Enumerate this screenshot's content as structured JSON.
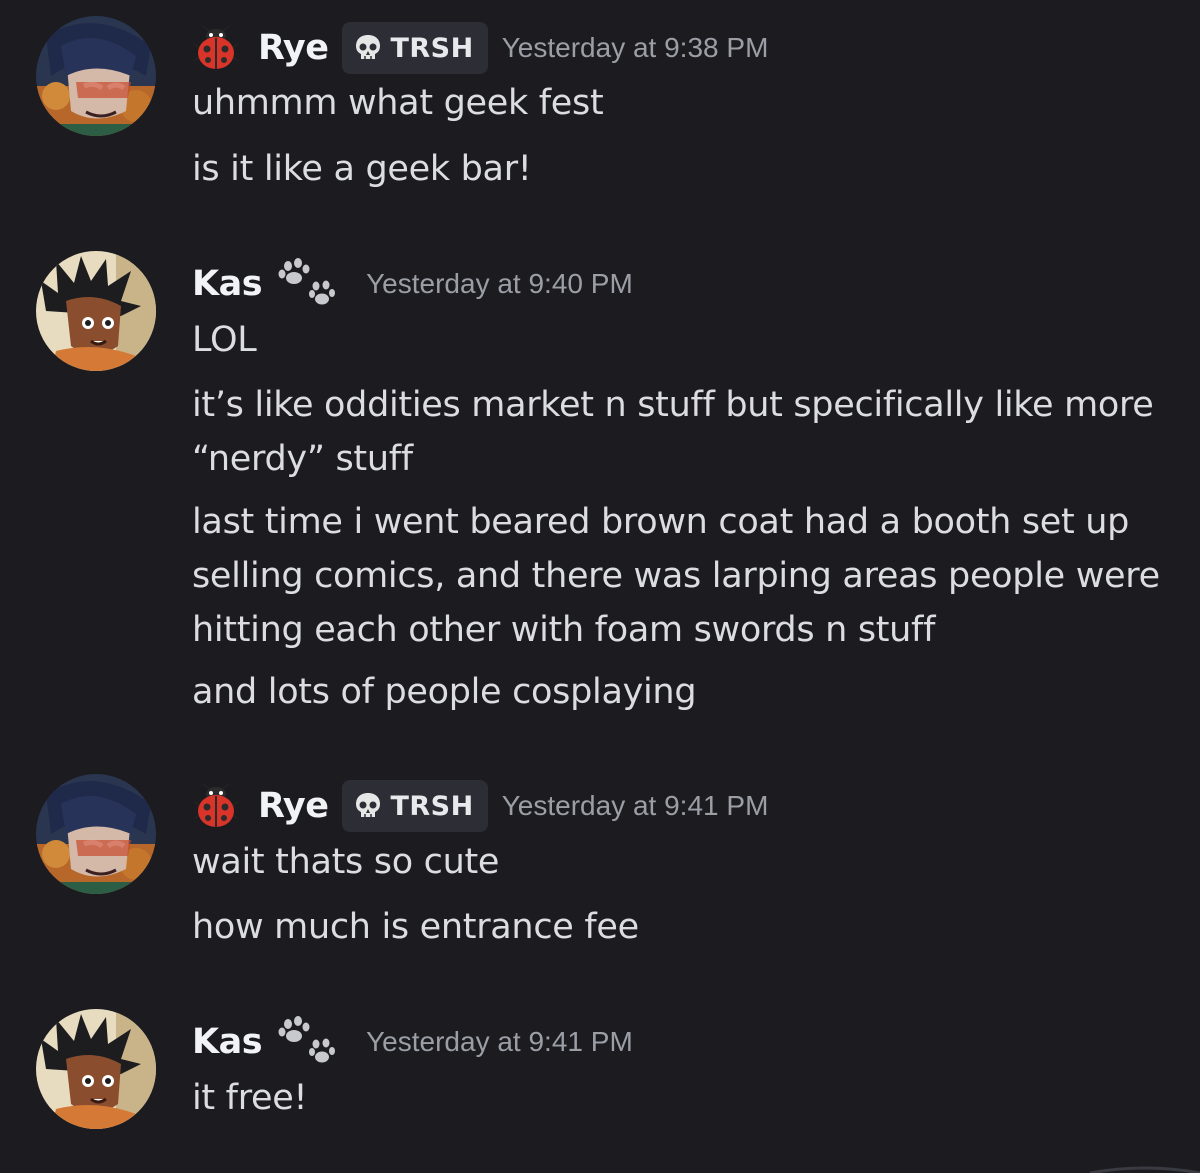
{
  "messages": [
    {
      "author": "Rye",
      "role_icon": "ladybug-icon",
      "tag": {
        "icon": "skull-icon",
        "text": "TRSH"
      },
      "timestamp": "Yesterday at 9:38 PM",
      "lines": [
        "uhmmm what geek fest",
        "is it like a geek bar!"
      ]
    },
    {
      "author": "Kas",
      "role_icon": "paw-icon",
      "timestamp": "Yesterday at 9:40 PM",
      "lines": [
        "LOL",
        "it’s like oddities market n stuff but specifically like more “nerdy” stuff",
        "last time i went beared brown coat had a booth set up selling comics, and there was larping areas people were hitting each other with foam swords n stuff",
        "and lots of people cosplaying"
      ]
    },
    {
      "author": "Rye",
      "role_icon": "ladybug-icon",
      "tag": {
        "icon": "skull-icon",
        "text": "TRSH"
      },
      "timestamp": "Yesterday at 9:41 PM",
      "lines": [
        "wait thats so cute",
        "how much is entrance fee"
      ]
    },
    {
      "author": "Kas",
      "role_icon": "paw-icon",
      "timestamp": "Yesterday at 9:41 PM",
      "lines": [
        "it free!"
      ]
    }
  ],
  "colors": {
    "background": "#1b1b20",
    "text": "#dcdde1",
    "username": "#f2f3f5",
    "timestamp": "#9c9ea6",
    "tag_background": "#2d2e35"
  }
}
